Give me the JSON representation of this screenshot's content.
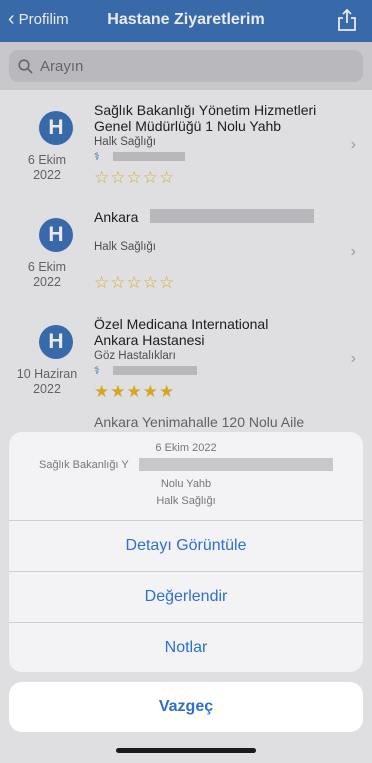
{
  "navbar": {
    "back_label": "Profilim",
    "title": "Hastane Ziyaretlerim"
  },
  "search": {
    "placeholder": "Arayın"
  },
  "visits": [
    {
      "avatar": "H",
      "date_day": "6 Ekim",
      "date_year": "2022",
      "name_line1": "Sağlık Bakanlığı Yönetim Hizmetleri",
      "name_line2": "Genel Müdürlüğü 1 Nolu Yahb",
      "department": "Halk Sağlığı",
      "rating": 0,
      "stars": "☆☆☆☆☆"
    },
    {
      "avatar": "H",
      "date_day": "6 Ekim",
      "date_year": "2022",
      "name_line1": "Ankara",
      "name_line2": "",
      "department": "Halk Sağlığı",
      "rating": 0,
      "stars": "☆☆☆☆☆"
    },
    {
      "avatar": "H",
      "date_day": "10 Haziran",
      "date_year": "2022",
      "name_line1": "Özel Medicana International",
      "name_line2": "Ankara Hastanesi",
      "department": "Göz Hastalıkları",
      "rating": 5,
      "stars": "★★★★★"
    },
    {
      "name_line1": "Ankara Yenimahalle 120 Nolu Aile"
    }
  ],
  "action_sheet": {
    "date": "6 Ekim 2022",
    "line2": "Sağlık Bakanlığı Y",
    "line3": "Nolu Yahb",
    "line4": "Halk Sağlığı",
    "actions": [
      "Detayı Görüntüle",
      "Değerlendir",
      "Notlar"
    ],
    "cancel": "Vazgeç"
  },
  "colors": {
    "navbar": "#3d73b9",
    "avatar": "#3d73b9",
    "action_text": "#2f6fd0",
    "star": "#e8b524"
  }
}
